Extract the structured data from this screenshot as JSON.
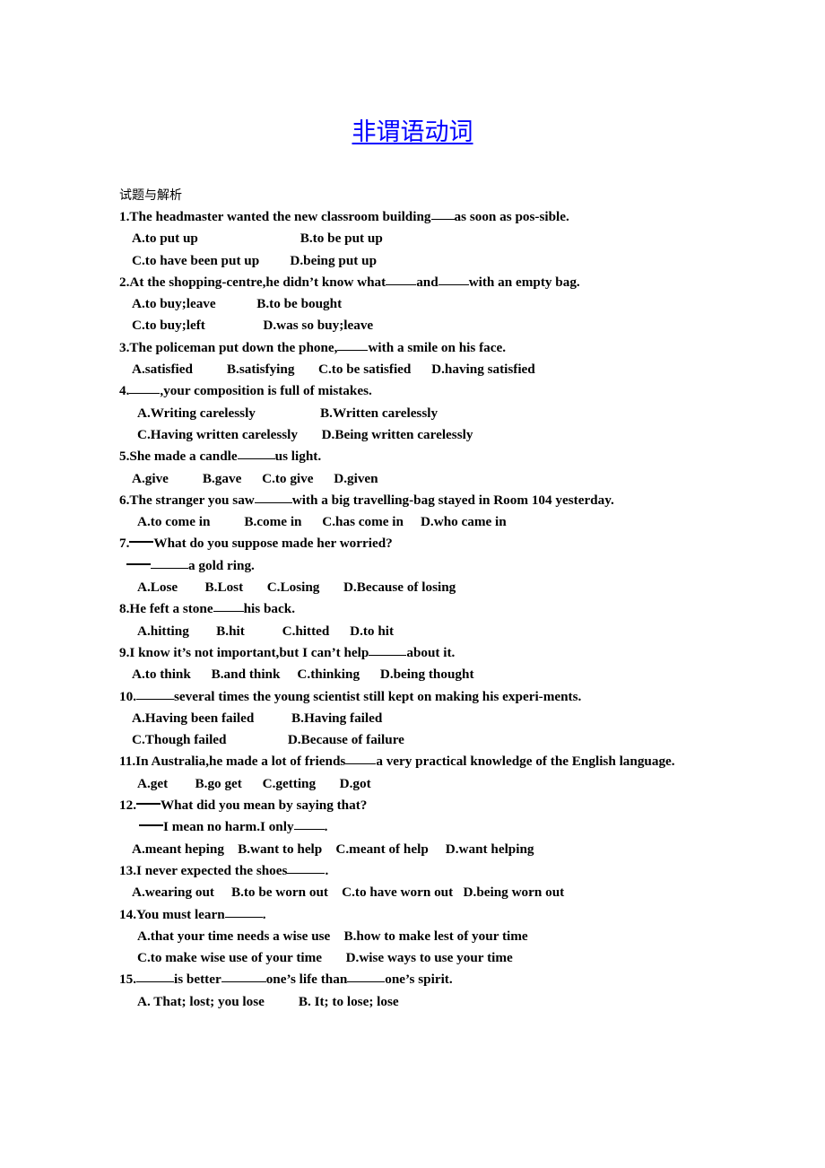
{
  "document": {
    "title": "非谓语动词",
    "section_label": "试题与解析"
  },
  "colors": {
    "title_blue": "#0000ff",
    "text_black": "#000000",
    "page_background": "#ffffff"
  },
  "questions": [
    {
      "number": "1.",
      "stem_parts": [
        "The headmaster wanted the new classroom building",
        "as soon as pos-sible."
      ],
      "rows": [
        {
          "indent": "ind1",
          "text": "A.to put up                              B.to be put up"
        },
        {
          "indent": "ind1",
          "text": "C.to have been put up         D.being put up"
        }
      ]
    },
    {
      "number": "2.",
      "stem_parts": [
        "At the shopping-centre,he didn’t know what",
        "and",
        "with an empty bag."
      ],
      "rows": [
        {
          "indent": "ind1",
          "text": "A.to buy;leave            B.to be bought"
        },
        {
          "indent": "ind1",
          "text": "C.to buy;left                 D.was so buy;leave"
        }
      ]
    },
    {
      "number": "3.",
      "stem_parts": [
        "The policeman put down the phone,",
        "with a smile on his face."
      ],
      "rows": [
        {
          "indent": "ind1",
          "text": "A.satisfied          B.satisfying       C.to be satisfied      D.having satisfied"
        }
      ]
    },
    {
      "number": "4.",
      "stem_parts": [
        "",
        ",your composition is full of mistakes."
      ],
      "rows": [
        {
          "indent": "ind2",
          "text": "A.Writing carelessly                   B.Written carelessly"
        },
        {
          "indent": "ind2",
          "text": "C.Having written carelessly       D.Being written carelessly"
        }
      ]
    },
    {
      "number": "5.",
      "stem_parts": [
        "She made a candle",
        "us light."
      ],
      "rows": [
        {
          "indent": "ind1",
          "text": "A.give          B.gave      C.to give      D.given"
        }
      ]
    },
    {
      "number": "6.",
      "stem_parts": [
        "The stranger you saw",
        "with a big travelling-bag stayed in Room 104 yesterday."
      ],
      "justified": true,
      "rows": [
        {
          "indent": "ind2",
          "text": "A.to come in          B.come in      C.has come in     D.who came in"
        }
      ]
    },
    {
      "number": "7.",
      "dialogue": true,
      "stem_parts": [
        "What do you suppose made her worried?"
      ],
      "reply_parts": [
        "",
        "a gold ring."
      ],
      "rows": [
        {
          "indent": "ind2",
          "text": "A.Lose        B.Lost       C.Losing       D.Because of losing"
        }
      ]
    },
    {
      "number": "8.",
      "stem_parts": [
        "He feft a stone",
        "his back."
      ],
      "rows": [
        {
          "indent": "ind2",
          "text": "A.hitting        B.hit           C.hitted      D.to hit"
        }
      ]
    },
    {
      "number": "9.",
      "stem_parts": [
        "I know it’s not important,but I can’t help",
        "about it."
      ],
      "rows": [
        {
          "indent": "ind1",
          "text": "A.to think      B.and think     C.thinking      D.being thought"
        }
      ]
    },
    {
      "number": "10.",
      "stem_parts": [
        "",
        "several times the young scientist still kept on making his experi-ments."
      ],
      "rows": [
        {
          "indent": "ind1",
          "text": "A.Having been failed           B.Having failed"
        },
        {
          "indent": "ind1",
          "text": "C.Though failed                  D.Because of failure"
        }
      ]
    },
    {
      "number": "11.",
      "stem_parts": [
        "In Australia,he made a lot of friends",
        "a very practical knowledge of the English language."
      ],
      "justified": true,
      "rows": [
        {
          "indent": "ind2",
          "text": "A.get        B.go get      C.getting       D.got"
        }
      ]
    },
    {
      "number": "12.",
      "dialogue": true,
      "stem_parts": [
        "What did you mean by saying that?"
      ],
      "reply_parts": [
        "I mean no harm.I only",
        "."
      ],
      "rows": [
        {
          "indent": "ind1",
          "text": "A.meant heping    B.want to help    C.meant of help     D.want helping"
        }
      ]
    },
    {
      "number": "13.",
      "stem_parts": [
        "I never expected the shoes",
        "."
      ],
      "rows": [
        {
          "indent": "ind1",
          "text": "A.wearing out     B.to be worn out    C.to have worn out   D.being worn out"
        }
      ]
    },
    {
      "number": "14.",
      "stem_parts": [
        "You must learn",
        "."
      ],
      "rows": [
        {
          "indent": "ind2",
          "text": "A.that your time needs a wise use    B.how to make lest of your time"
        },
        {
          "indent": "ind2",
          "text": "C.to make wise use of your time       D.wise ways to use your time"
        }
      ]
    },
    {
      "number": "15.",
      "stem_parts": [
        "",
        "is better",
        "one’s life than",
        "one’s spirit."
      ],
      "rows": [
        {
          "indent": "ind2",
          "text": "A. That; lost; you lose          B. It; to lose; lose"
        }
      ]
    }
  ]
}
